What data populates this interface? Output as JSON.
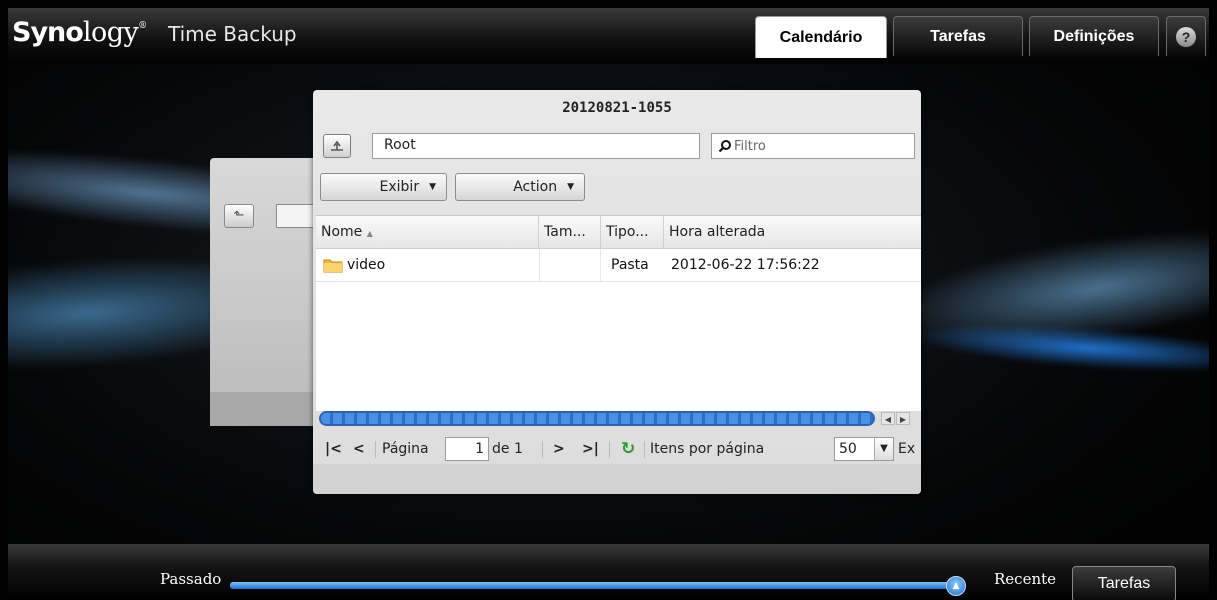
{
  "header": {
    "logo_bold": "Syno",
    "logo_rest": "logy",
    "logo_mark": "®",
    "app_title": "Time Backup",
    "tabs": [
      {
        "label": "Calendário",
        "active": true
      },
      {
        "label": "Tarefas",
        "active": false
      },
      {
        "label": "Definições",
        "active": false
      }
    ],
    "help_label": "?"
  },
  "browser": {
    "title": "20120821-1055",
    "path_value": "Root",
    "filter_placeholder": "Filtro",
    "view_button": "Exibir",
    "action_button": "Action",
    "columns": [
      "Nome",
      "Tam...",
      "Tipo...",
      "Hora alterada"
    ],
    "rows": [
      {
        "name": "video",
        "size": "",
        "type": "Pasta",
        "modified": "2012-06-22 17:56:22",
        "icon": "folder-icon"
      }
    ],
    "pager": {
      "page_label": "Página",
      "page_value": "1",
      "of_label": "de 1",
      "items_label": "Itens por página",
      "items_value": "50",
      "trailing_label": "Ex"
    }
  },
  "timeline": {
    "past_label": "Passado",
    "recent_label": "Recente",
    "tasks_button": "Tarefas",
    "position_fraction": 1.0
  },
  "colors": {
    "accent_blue": "#2d6cc8",
    "refresh_green": "#2e9a2e"
  }
}
